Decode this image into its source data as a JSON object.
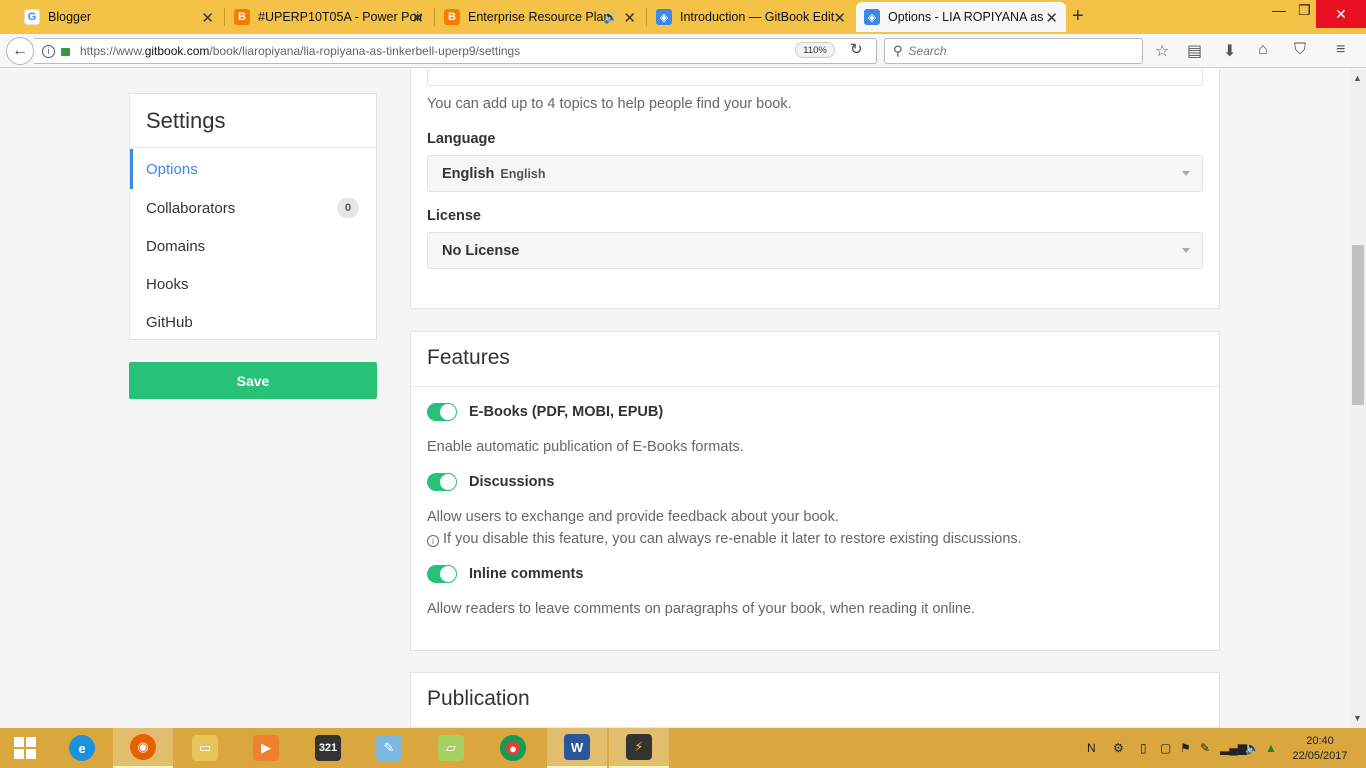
{
  "browser": {
    "tabs": [
      {
        "label": "Blogger",
        "icon": "google-g-icon"
      },
      {
        "label": "#UPERP10T05A - Power Poin",
        "icon": "blogger-icon"
      },
      {
        "label": "Enterprise Resource Plan",
        "icon": "blogger-icon"
      },
      {
        "label": "Introduction — GitBook Edit",
        "icon": "gitbook-icon"
      },
      {
        "label": "Options - LIA ROPIYANA as",
        "icon": "gitbook-icon"
      }
    ],
    "url_prefix": "https://www.",
    "url_host": "gitbook.com",
    "url_path": "/book/liaropiyana/lia-ropiyana-as-tinkerbell-uperp9/settings",
    "zoom": "110%",
    "search_placeholder": "Search"
  },
  "sidebar": {
    "title": "Settings",
    "items": [
      {
        "label": "Options"
      },
      {
        "label": "Collaborators",
        "badge": "0"
      },
      {
        "label": "Domains"
      },
      {
        "label": "Hooks"
      },
      {
        "label": "GitHub"
      }
    ],
    "save_label": "Save"
  },
  "options": {
    "topics_help": "You can add up to 4 topics to help people find your book.",
    "language_label": "Language",
    "language_value": "English",
    "language_native": "English",
    "license_label": "License",
    "license_value": "No License"
  },
  "features": {
    "title": "Features",
    "items": [
      {
        "name": "E-Books (PDF, MOBI, EPUB)",
        "enabled": true,
        "desc": "Enable automatic publication of E-Books formats."
      },
      {
        "name": "Discussions",
        "enabled": true,
        "desc": "Allow users to exchange and provide feedback about your book.",
        "note": "If you disable this feature, you can always re-enable it later to restore existing discussions."
      },
      {
        "name": "Inline comments",
        "enabled": true,
        "desc": "Allow readers to leave comments on paragraphs of your book, when reading it online."
      }
    ]
  },
  "publication": {
    "title": "Publication"
  },
  "taskbar": {
    "time": "20:40",
    "date": "22/05/2017"
  },
  "colors": {
    "accent_blue": "#3b88e8",
    "accent_green": "#27c277",
    "tabbar": "#f3c246",
    "taskbar": "#d9a73e"
  }
}
